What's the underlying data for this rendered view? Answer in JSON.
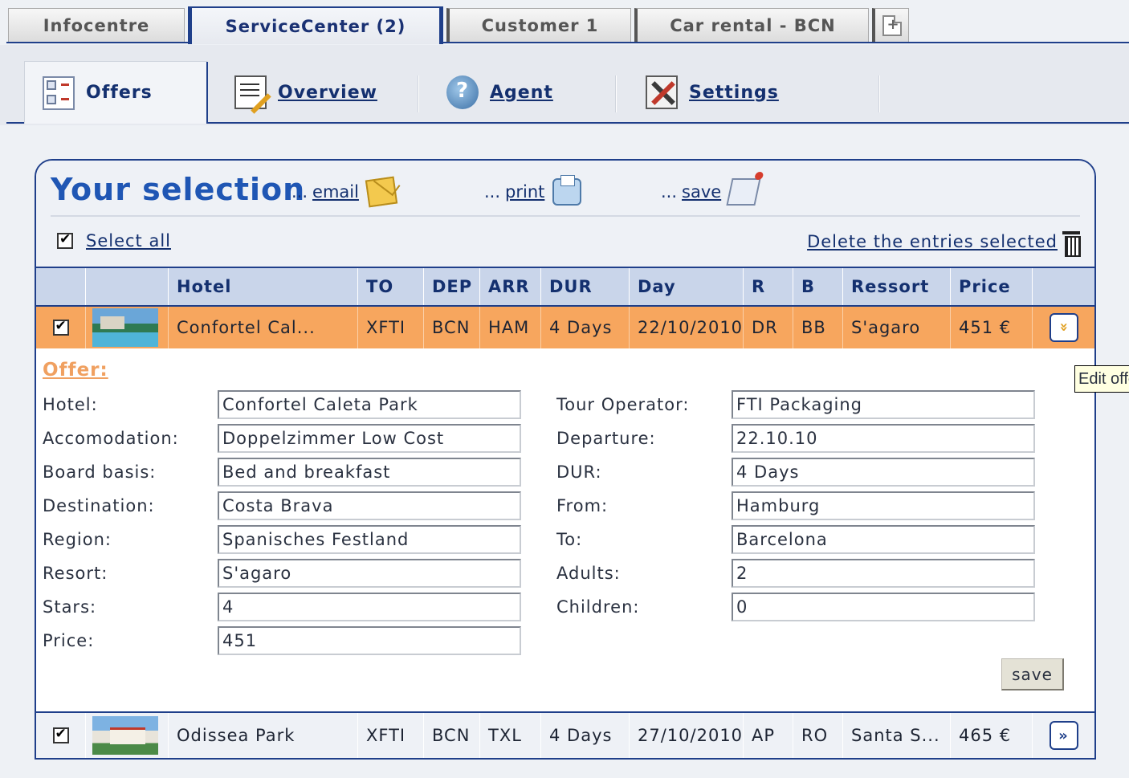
{
  "top_tabs": [
    {
      "label": "Infocentre"
    },
    {
      "label": "ServiceCenter (2)"
    },
    {
      "label": "Customer 1"
    },
    {
      "label": "Car rental - BCN"
    }
  ],
  "sub_tabs": [
    {
      "label": "Offers",
      "icon": "offers-icon"
    },
    {
      "label": "Overview",
      "icon": "overview-icon"
    },
    {
      "label": "Agent",
      "icon": "agent-icon"
    },
    {
      "label": "Settings",
      "icon": "settings-icon"
    }
  ],
  "selection": {
    "title": "Your selection",
    "email_prefix": "...",
    "email_label": "email",
    "print_prefix": "...",
    "print_label": "print",
    "save_prefix": "...",
    "save_label": "save",
    "select_all_label": "Select all",
    "delete_label": "Delete the entries selected"
  },
  "table": {
    "headers": [
      "",
      "",
      "Hotel",
      "TO",
      "DEP",
      "ARR",
      "DUR",
      "Day",
      "R",
      "B",
      "Ressort",
      "Price",
      ""
    ],
    "rows": [
      {
        "hotel": "Confortel Cal...",
        "to": "XFTI",
        "dep": "BCN",
        "arr": "HAM",
        "dur": "4 Days",
        "day": "22/10/2010",
        "r": "DR",
        "b": "BB",
        "ressort": "S'agaro",
        "price": "451 €",
        "toggle": "»"
      },
      {
        "hotel": "Odissea Park",
        "to": "XFTI",
        "dep": "BCN",
        "arr": "TXL",
        "dur": "4 Days",
        "day": "27/10/2010",
        "r": "AP",
        "b": "RO",
        "ressort": "Santa S...",
        "price": "465 €",
        "toggle": "»"
      }
    ]
  },
  "offer": {
    "title": "Offer:",
    "left": [
      {
        "label": "Hotel:",
        "value": "Confortel Caleta Park"
      },
      {
        "label": "Accomodation:",
        "value": "Doppelzimmer Low Cost"
      },
      {
        "label": "Board basis:",
        "value": "Bed and breakfast"
      },
      {
        "label": "Destination:",
        "value": "Costa Brava"
      },
      {
        "label": "Region:",
        "value": "Spanisches Festland"
      },
      {
        "label": "Resort:",
        "value": "S'agaro"
      },
      {
        "label": "Stars:",
        "value": "4"
      },
      {
        "label": "Price:",
        "value": "451"
      }
    ],
    "right": [
      {
        "label": "Tour Operator:",
        "value": "FTI Packaging"
      },
      {
        "label": "Departure:",
        "value": "22.10.10"
      },
      {
        "label": "DUR:",
        "value": "4 Days"
      },
      {
        "label": "From:",
        "value": "Hamburg"
      },
      {
        "label": "To:",
        "value": "Barcelona"
      },
      {
        "label": "Adults:",
        "value": "2"
      },
      {
        "label": "Children:",
        "value": "0"
      }
    ],
    "save_label": "save"
  },
  "tooltip": "Edit offer",
  "colors": {
    "accent": "#1f3f8a",
    "title": "#1f56b4",
    "selected_row": "#f7a65e",
    "offer_title": "#f0a060"
  }
}
